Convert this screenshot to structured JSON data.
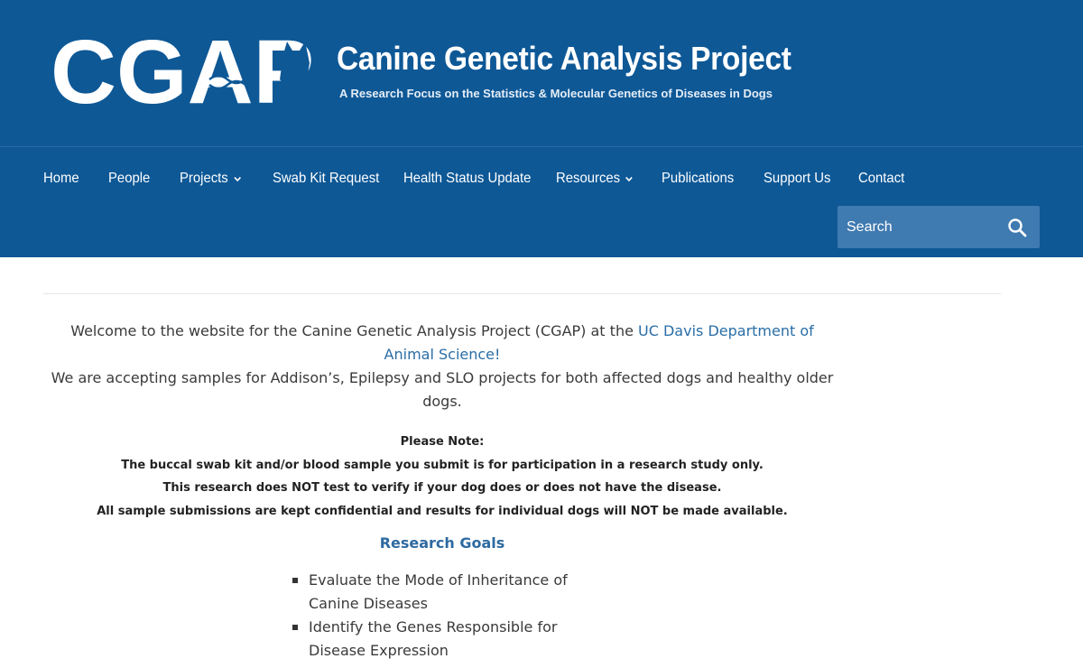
{
  "header": {
    "logo_text": "CGAP",
    "title": "Canine Genetic Analysis Project",
    "tagline": "A Research Focus on the Statistics & Molecular Genetics of Diseases in Dogs"
  },
  "nav": {
    "items": [
      {
        "label": "Home",
        "dropdown": false
      },
      {
        "label": "People",
        "dropdown": false
      },
      {
        "label": "Projects",
        "dropdown": true
      },
      {
        "label": "Swab Kit Request",
        "dropdown": false
      },
      {
        "label": "Health Status Update",
        "dropdown": false
      },
      {
        "label": "Resources",
        "dropdown": true
      },
      {
        "label": "Publications",
        "dropdown": false
      },
      {
        "label": "Support Us",
        "dropdown": false
      },
      {
        "label": "Contact",
        "dropdown": false
      }
    ]
  },
  "search": {
    "placeholder": "Search",
    "icon": "search-icon"
  },
  "main": {
    "welcome_text": "Welcome to the website for the Canine Genetic Analysis Project (CGAP) at the ",
    "welcome_link": "UC Davis Department of Animal Science!",
    "accepting": "We are accepting samples for Addison’s, Epilepsy and SLO projects for both affected dogs and healthy older dogs.",
    "note_heading": "Please Note:",
    "note_lines": [
      "The buccal swab kit and/or blood sample you submit is for participation in a research study only.",
      "This research does NOT test to verify if your dog does or does not have the disease.",
      "All sample submissions are kept confidential and results for individual dogs will NOT be made available."
    ],
    "goals_heading": "Research Goals",
    "goals": [
      "Evaluate the Mode of Inheritance of Canine Diseases",
      "Identify the Genes Responsible for Disease Expression"
    ]
  },
  "colors": {
    "header_bg": "#0e5896",
    "link": "#2a6ea6",
    "search_bg": "#3f7ab0"
  }
}
